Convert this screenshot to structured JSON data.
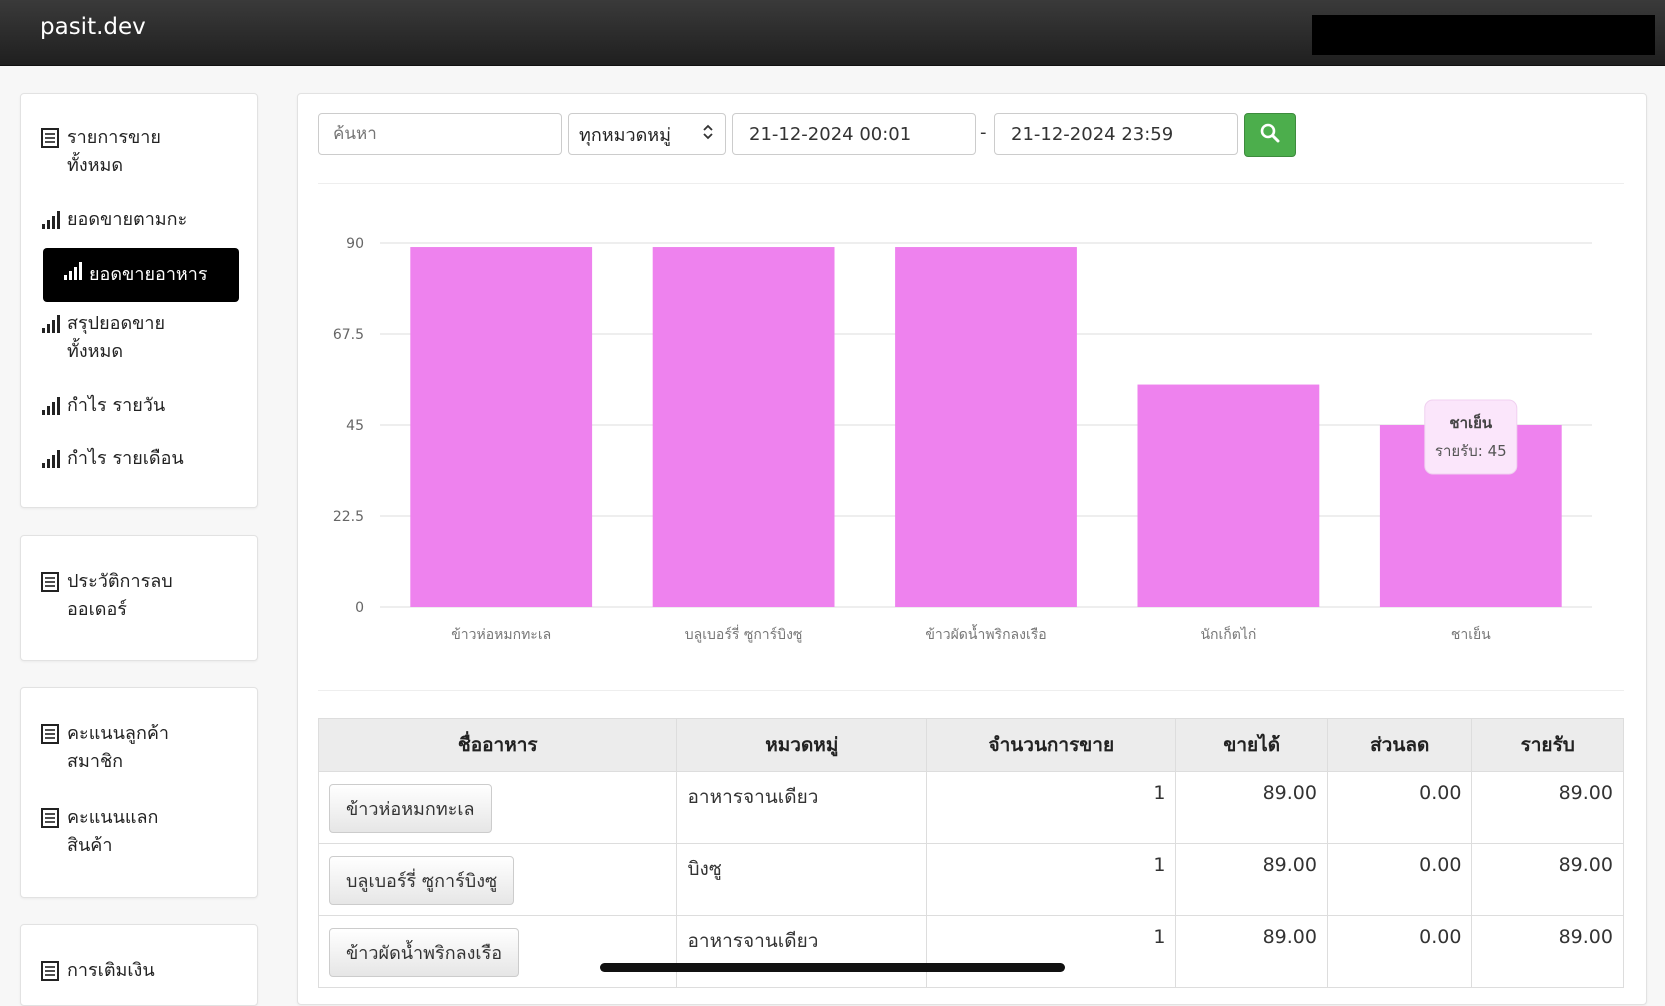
{
  "app": {
    "brand": "pasit.dev"
  },
  "sidebar": {
    "group1": [
      {
        "label": "รายการขาย ทั้งหมด",
        "icon": "list-icon"
      },
      {
        "label": "ยอดขายตามกะ",
        "icon": "bar-chart-icon"
      },
      {
        "label": "ยอดขายอาหาร",
        "icon": "bar-chart-icon",
        "active": true
      },
      {
        "label": "สรุปยอดขาย ทั้งหมด",
        "icon": "bar-chart-icon"
      },
      {
        "label": "กำไร รายวัน",
        "icon": "bar-chart-icon"
      },
      {
        "label": "กำไร รายเดือน",
        "icon": "bar-chart-icon"
      }
    ],
    "group2": [
      {
        "label": "ประวัติการลบ ออเดอร์",
        "icon": "list-icon"
      }
    ],
    "group3": [
      {
        "label": "คะแนนลูกค้า สมาชิก",
        "icon": "list-icon"
      },
      {
        "label": "คะแนนแลก สินค้า",
        "icon": "list-icon"
      }
    ],
    "group4": [
      {
        "label": "การเติมเงิน",
        "icon": "list-icon"
      }
    ]
  },
  "filters": {
    "search_placeholder": "ค้นหา",
    "category": "ทุกหมวดหมู่",
    "date_from": "21-12-2024 00:01",
    "separator": "-",
    "date_to": "21-12-2024 23:59",
    "search_icon": "search-icon"
  },
  "chart_data": {
    "type": "bar",
    "categories": [
      "ข้าวห่อหมกทะเล",
      "บลูเบอร์รี่ ซูการ์บิงซู",
      "ข้าวผัดน้ำพริกลงเรือ",
      "นักเก็ตไก่",
      "ชาเย็น"
    ],
    "series": [
      {
        "name": "รายรับ",
        "values": [
          89,
          89,
          89,
          55,
          45
        ]
      }
    ],
    "ylim": [
      0,
      90
    ],
    "yticks": [
      "0",
      "22.5",
      "45",
      "67.5",
      "90"
    ],
    "bar_color": "#ee82ee",
    "grid": true,
    "tooltip": {
      "title": "ชาเย็น",
      "text": "รายรับ: 45"
    }
  },
  "table": {
    "headers": [
      "ชื่ออาหาร",
      "หมวดหมู่",
      "จำนวนการขาย",
      "ขายได้",
      "ส่วนลด",
      "รายรับ"
    ],
    "rows": [
      {
        "name": "ข้าวห่อหมกทะเล",
        "category": "อาหารจานเดียว",
        "qty": "1",
        "sold": "89.00",
        "discount": "0.00",
        "revenue": "89.00"
      },
      {
        "name": "บลูเบอร์รี่ ซูการ์บิงซู",
        "category": "บิงซู",
        "qty": "1",
        "sold": "89.00",
        "discount": "0.00",
        "revenue": "89.00"
      },
      {
        "name": "ข้าวผัดน้ำพริกลงเรือ",
        "category": "อาหารจานเดียว",
        "qty": "1",
        "sold": "89.00",
        "discount": "0.00",
        "revenue": "89.00"
      }
    ]
  }
}
